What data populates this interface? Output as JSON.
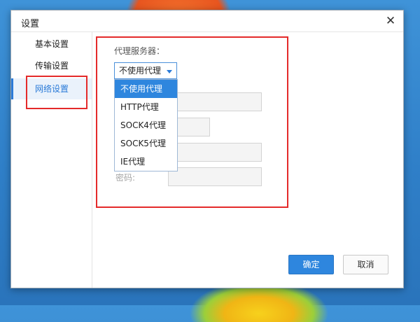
{
  "dialog": {
    "title": "设置",
    "close_glyph": "✕"
  },
  "sidebar": {
    "items": [
      {
        "label": "基本设置"
      },
      {
        "label": "传输设置"
      },
      {
        "label": "网络设置",
        "active": true
      }
    ]
  },
  "proxy": {
    "section_label": "代理服务器：",
    "selected_value": "不使用代理",
    "options": [
      "不使用代理",
      "HTTP代理",
      "SOCK4代理",
      "SOCK5代理",
      "IE代理"
    ],
    "password_label": "密码:"
  },
  "buttons": {
    "ok": "确定",
    "cancel": "取消"
  },
  "colors": {
    "accent": "#2e86de",
    "highlight_box": "#e42a2a"
  }
}
